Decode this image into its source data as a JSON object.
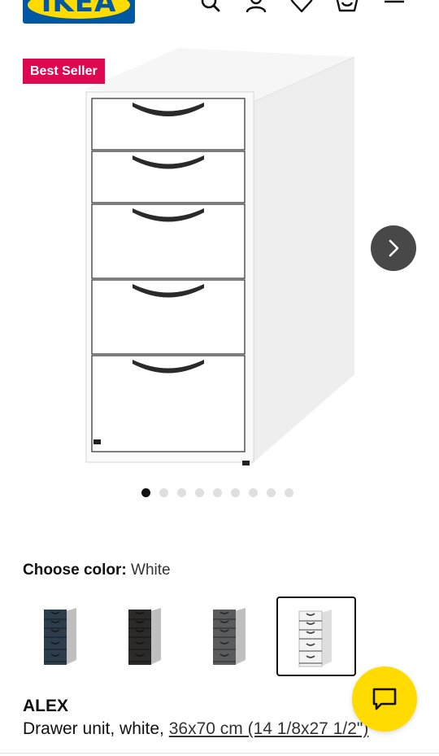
{
  "brand": {
    "logo_text": "IKEA",
    "blue": "#0058a3",
    "yellow": "#ffdb00"
  },
  "header": {
    "icons": [
      "search-icon",
      "account-icon",
      "heart-icon",
      "cart-icon",
      "menu-icon"
    ]
  },
  "product": {
    "badge": "Best Seller",
    "badge_color": "#e00751",
    "carousel": {
      "total": 9,
      "active": 1
    },
    "color": {
      "label": "Choose color:",
      "value": "White"
    },
    "swatches": [
      {
        "name": "Blue",
        "hex": "#2e3d4c",
        "selected": false
      },
      {
        "name": "Black-brown",
        "hex": "#2b2a28",
        "selected": false
      },
      {
        "name": "Gray-turquoise",
        "hex": "#5a5b5c",
        "selected": false
      },
      {
        "name": "White",
        "hex": "#f3f3f3",
        "selected": true
      }
    ],
    "name": "ALEX",
    "description_prefix": "Drawer unit, white, ",
    "measurement": "36x70 cm (14 1/8x27 1/2\")"
  }
}
